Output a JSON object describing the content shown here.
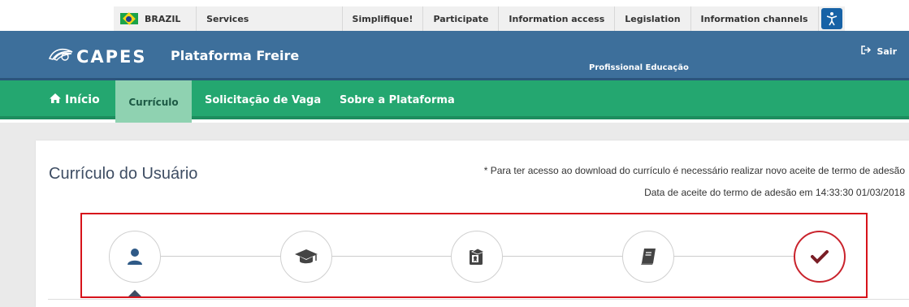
{
  "govbar": {
    "items": [
      {
        "label": "BRAZIL"
      },
      {
        "label": "Services"
      },
      {
        "label": "Simplifique!"
      },
      {
        "label": "Participate"
      },
      {
        "label": "Information access"
      },
      {
        "label": "Legislation"
      },
      {
        "label": "Information channels"
      }
    ],
    "accessibility_icon": "accessibility-icon"
  },
  "header": {
    "logo": "CAPES",
    "platform": "Plataforma Freire",
    "profile": "Profissional Educação",
    "logout": "Sair"
  },
  "nav": {
    "items": [
      {
        "label": "Início",
        "icon": "home-icon"
      },
      {
        "label": "Currículo",
        "active": true
      },
      {
        "label": "Solicitação de Vaga"
      },
      {
        "label": "Sobre a Plataforma"
      }
    ]
  },
  "main": {
    "title": "Currículo do Usuário",
    "notice": "* Para ter acesso ao download do currículo é necessário realizar novo aceite de termo de adesão",
    "accept_date": "Data de aceite do termo de adesão em 14:33:30 01/03/2018"
  },
  "stepper": {
    "steps": [
      {
        "icon": "user-icon",
        "color": "#2f5a87"
      },
      {
        "icon": "graduation-cap-icon",
        "color": "#444444"
      },
      {
        "icon": "certificate-icon",
        "color": "#444444"
      },
      {
        "icon": "book-icon",
        "color": "#444444"
      },
      {
        "icon": "check-icon",
        "color": "#7a1e26"
      }
    ],
    "highlight_color": "#d7131b"
  },
  "colors": {
    "header_blue": "#3d6f9b",
    "nav_green": "#24a770",
    "active_tab": "#8fd2b1"
  }
}
